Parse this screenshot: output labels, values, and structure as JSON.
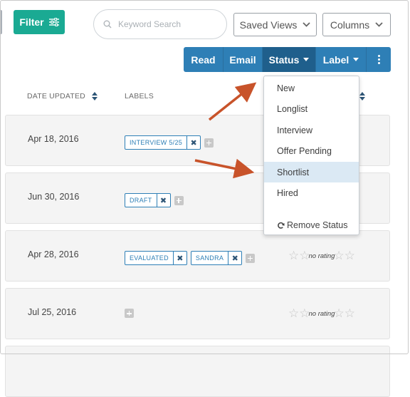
{
  "toolbar": {
    "filter_label": "Filter",
    "search_placeholder": "Keyword Search",
    "saved_views_label": "Saved Views",
    "columns_label": "Columns"
  },
  "actions": {
    "read": "Read",
    "email": "Email",
    "status": "Status",
    "label": "Label"
  },
  "table": {
    "headers": {
      "date_updated": "DATE UPDATED",
      "labels": "LABELS"
    },
    "rows": [
      {
        "date": "Apr 18, 2016",
        "labels": [
          "INTERVIEW 5/25"
        ],
        "rating": ""
      },
      {
        "date": "Jun 30, 2016",
        "labels": [
          "DRAFT"
        ],
        "rating": ""
      },
      {
        "date": "Apr 28, 2016",
        "labels": [
          "EVALUATED",
          "SANDRA"
        ],
        "rating": "no rating"
      },
      {
        "date": "Jul 25, 2016",
        "labels": [],
        "rating": "no rating"
      }
    ]
  },
  "status_menu": {
    "items": [
      "New",
      "Longlist",
      "Interview",
      "Offer Pending",
      "Shortlist",
      "Hired"
    ],
    "highlighted": "Shortlist",
    "remove_label": "Remove Status"
  },
  "colors": {
    "filter_green": "#1aaa93",
    "action_blue": "#2e7fb6",
    "annotation_arrow": "#c8532a"
  }
}
